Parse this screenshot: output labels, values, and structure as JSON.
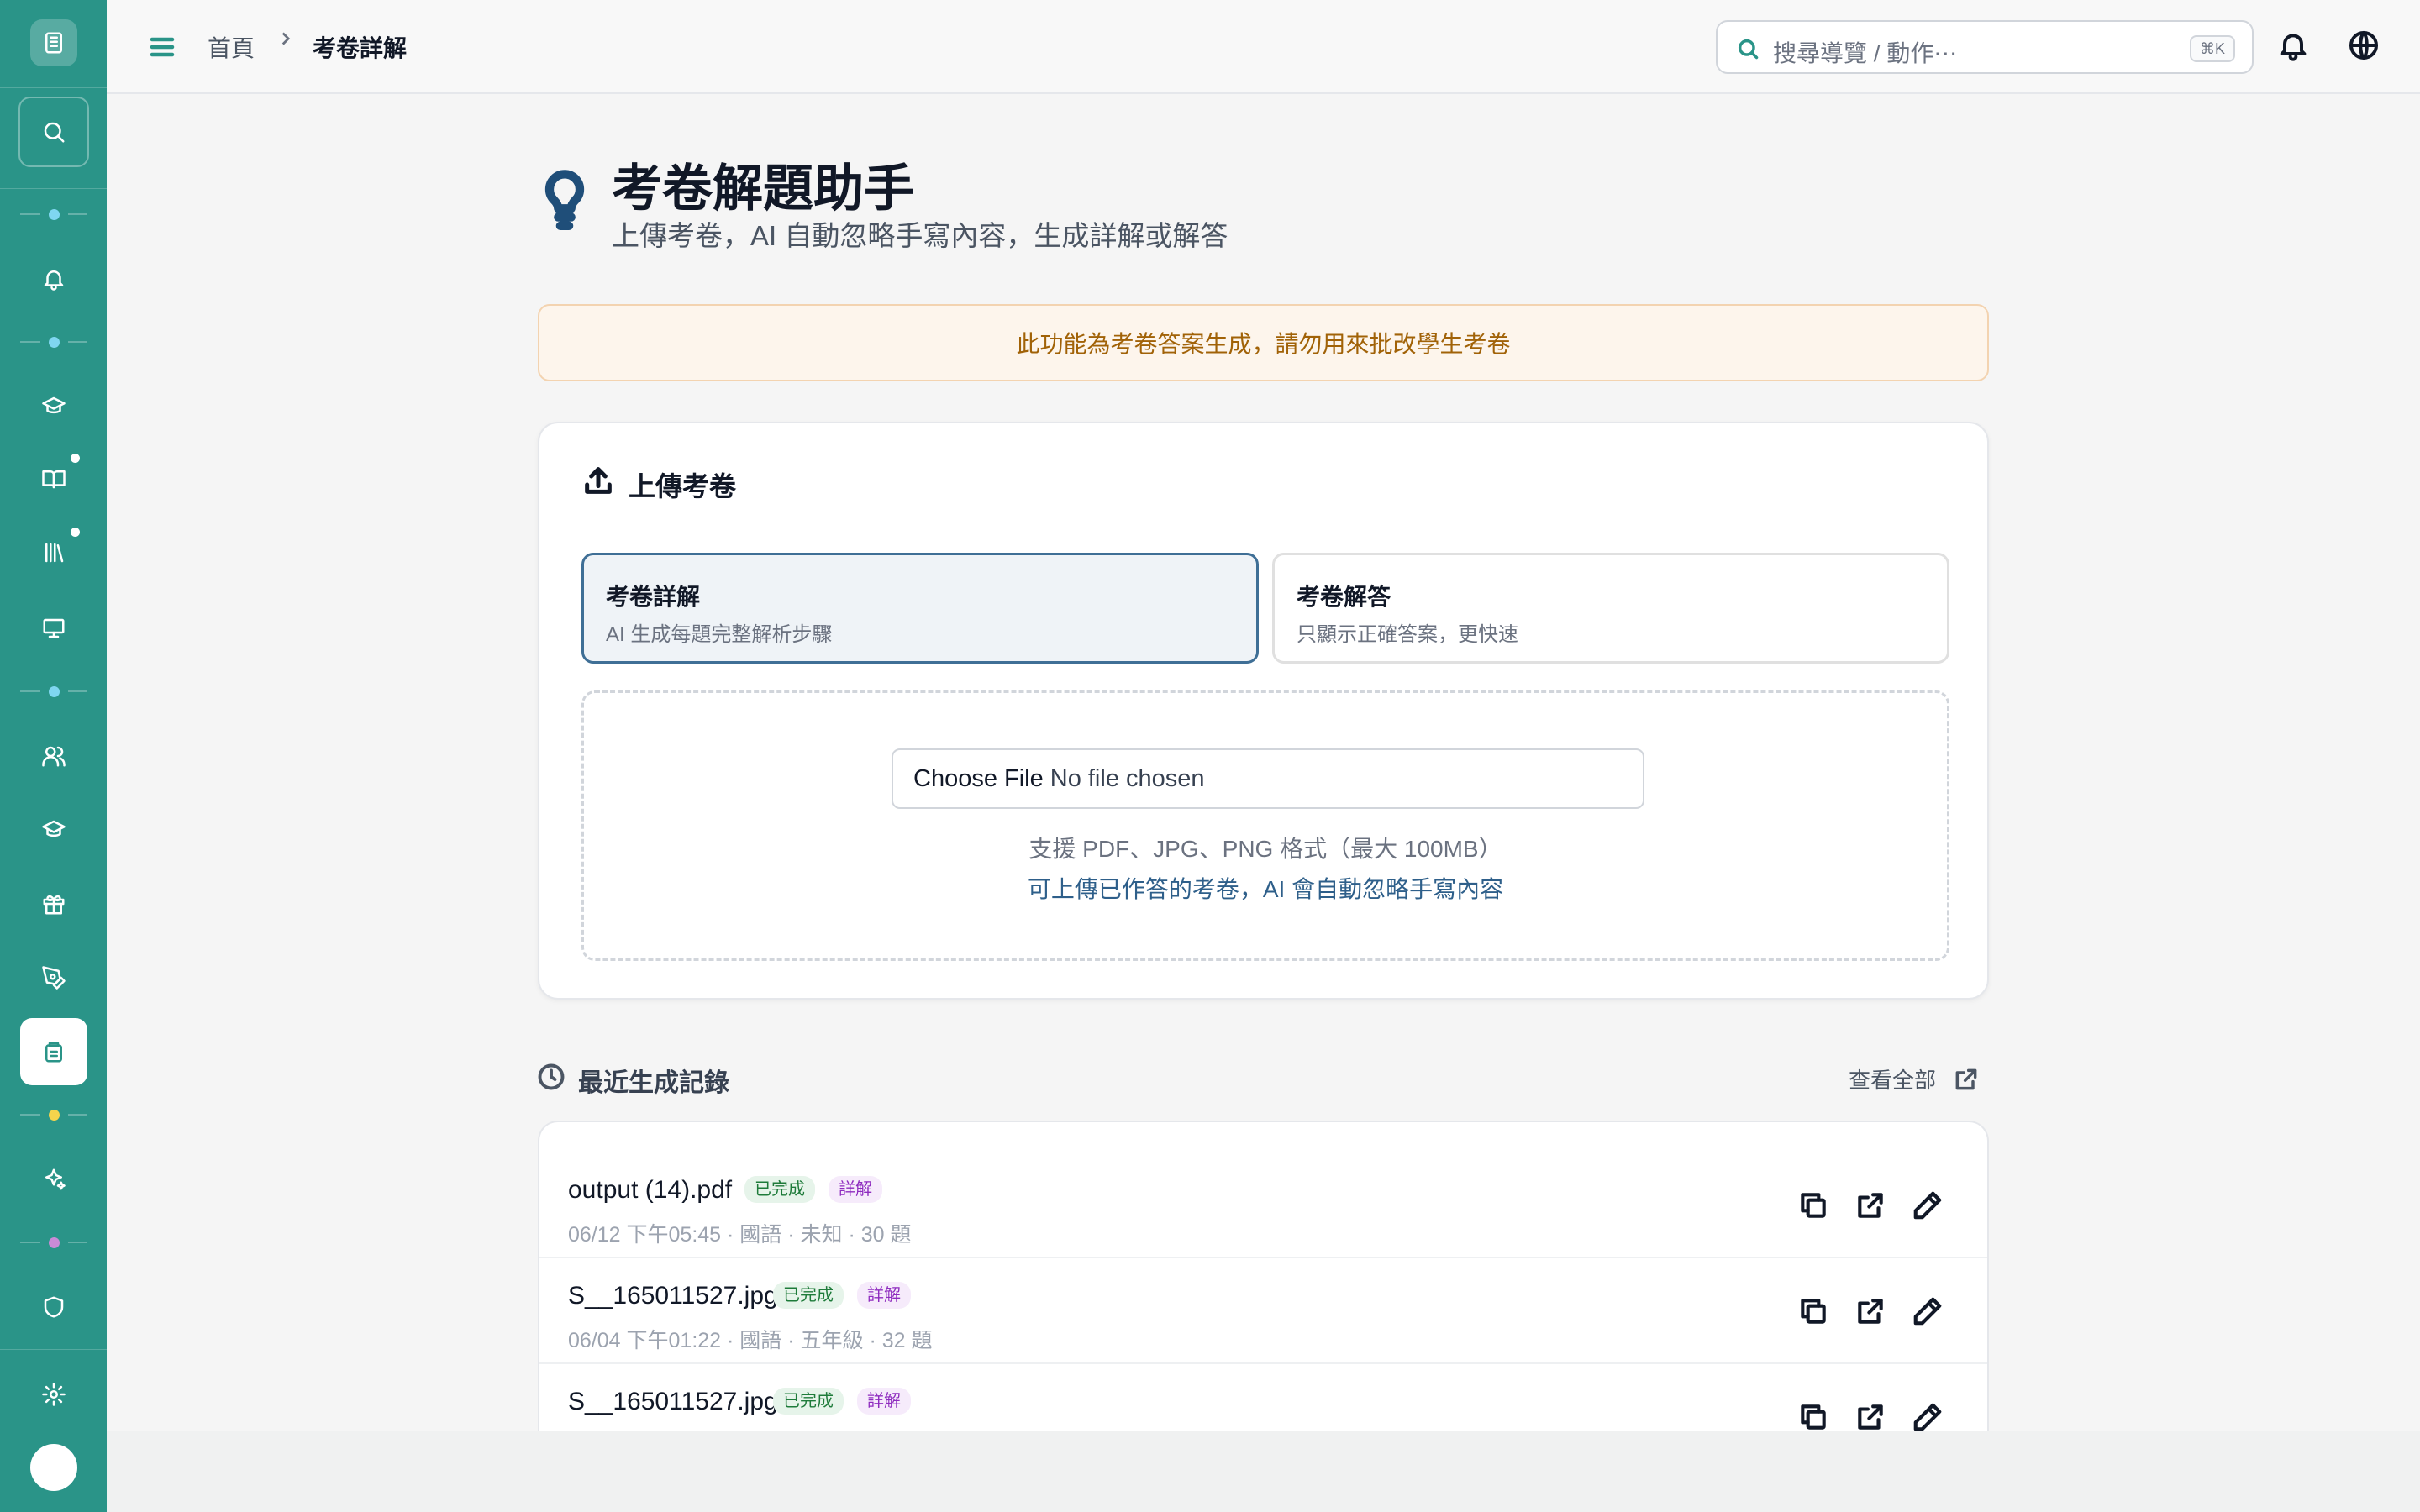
{
  "header": {
    "breadcrumb_home": "首頁",
    "breadcrumb_current": "考卷詳解",
    "search_placeholder": "搜尋導覽 / 動作⋯",
    "search_shortcut": "⌘K"
  },
  "page": {
    "title": "考卷解題助手",
    "subtitle": "上傳考卷，AI 自動忽略手寫內容，生成詳解或解答"
  },
  "notice": "此功能為考卷答案生成，請勿用來批改學生考卷",
  "upload": {
    "title": "上傳考卷",
    "modes": [
      {
        "title": "考卷詳解",
        "desc": "AI 生成每題完整解析步驟",
        "selected": true
      },
      {
        "title": "考卷解答",
        "desc": "只顯示正確答案，更快速",
        "selected": false
      }
    ],
    "file_button": "Choose File",
    "file_status": "No file chosen",
    "hint_formats": "支援 PDF、JPG、PNG 格式（最大 100MB）",
    "hint_handwriting": "可上傳已作答的考卷，AI 會自動忽略手寫內容"
  },
  "recent": {
    "title": "最近生成記錄",
    "view_all": "查看全部",
    "items": [
      {
        "name": "output (14).pdf",
        "status": "已完成",
        "type": "詳解",
        "meta": "06/12 下午05:45  · 國語  · 未知  · 30 題"
      },
      {
        "name": "S__165011527.jpg",
        "status": "已完成",
        "type": "詳解",
        "meta": "06/04 下午01:22  · 國語  · 五年級  · 32 題"
      },
      {
        "name": "S__165011527.jpg",
        "status": "已完成",
        "type": "詳解",
        "meta": ""
      }
    ]
  },
  "colors": {
    "sidebar": "#2a9488",
    "primary_blue": "#3f6f96",
    "notice_bg": "#fdf5ec",
    "notice_text": "#a16207"
  },
  "sidebar_icons": [
    "logo-icon",
    "search-icon",
    "bell-icon",
    "graduation-cap-icon",
    "book-icon",
    "library-icon",
    "monitor-icon",
    "users-icon",
    "graduation-cap-icon",
    "gift-icon",
    "pen-tool-icon",
    "exam-icon",
    "sparkles-icon",
    "shield-icon",
    "settings-icon"
  ]
}
